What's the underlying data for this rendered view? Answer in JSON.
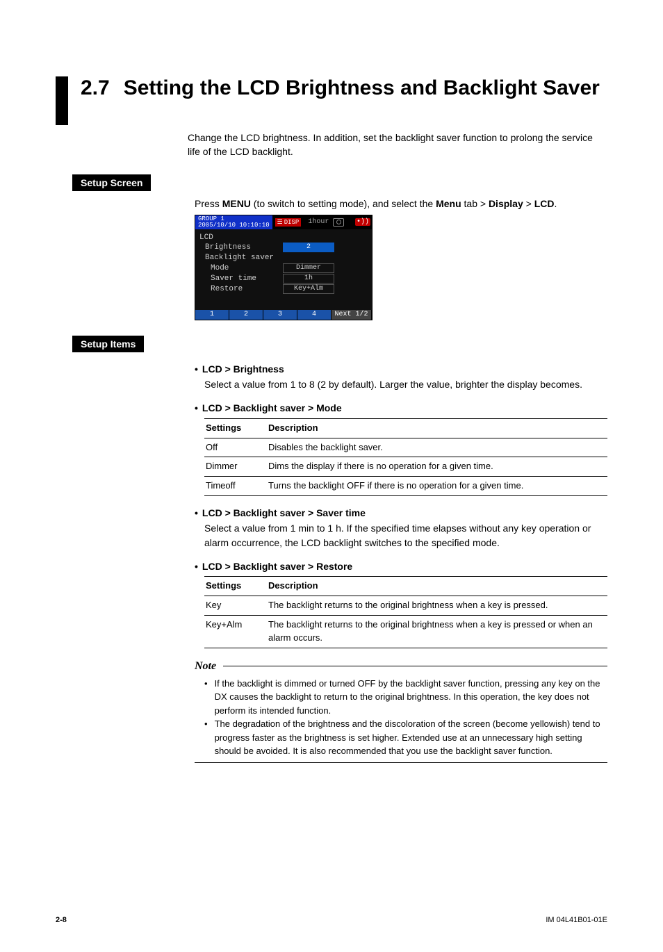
{
  "section": {
    "number": "2.7",
    "title": "Setting the LCD Brightness and Backlight Saver"
  },
  "intro": "Change the LCD brightness. In addition, set the backlight saver function to prolong the service life of the LCD backlight.",
  "tags": {
    "setup_screen": "Setup Screen",
    "setup_items": "Setup Items"
  },
  "press_line": {
    "prefix": "Press ",
    "menu1": "MENU",
    "mid": " (to switch to setting mode), and select the ",
    "menu2": "Menu",
    "sep1": " tab > ",
    "display": "Display",
    "sep2": " > ",
    "lcd": "LCD",
    "end": "."
  },
  "screenshot": {
    "group": "GROUP 1",
    "datetime": "2005/10/10 10:10:10",
    "disp": "DISP",
    "onehour": "1hour",
    "lcd_label": "LCD",
    "rows": {
      "brightness": "Brightness",
      "backlight_saver": "Backlight saver",
      "mode": "Mode",
      "saver_time": "Saver time",
      "restore": "Restore"
    },
    "vals": {
      "brightness": "2",
      "mode": "Dimmer",
      "saver_time": "1h",
      "restore": "Key+Alm"
    },
    "footer": {
      "b1": "1",
      "b2": "2",
      "b3": "3",
      "b4": "4",
      "next": "Next 1/2"
    }
  },
  "items": {
    "brightness": {
      "head": "LCD > Brightness",
      "body": "Select a value from 1 to 8 (2 by default). Larger the value, brighter the display becomes."
    },
    "mode": {
      "head": "LCD > Backlight saver > Mode",
      "th1": "Settings",
      "th2": "Description",
      "rows": [
        {
          "s": "Off",
          "d": "Disables the backlight saver."
        },
        {
          "s": "Dimmer",
          "d": "Dims the display if there is no operation for a given time."
        },
        {
          "s": "Timeoff",
          "d": "Turns the backlight OFF if there is no operation for a given time."
        }
      ]
    },
    "saver_time": {
      "head": "LCD > Backlight saver > Saver time",
      "body": "Select a value from 1 min to 1 h. If the specified time elapses without any key operation or alarm occurrence, the LCD backlight switches to the specified mode."
    },
    "restore": {
      "head": "LCD > Backlight saver > Restore",
      "th1": "Settings",
      "th2": "Description",
      "rows": [
        {
          "s": "Key",
          "d": "The backlight returns to the original brightness when a key is pressed."
        },
        {
          "s": "Key+Alm",
          "d": "The backlight returns to the original brightness when a key is pressed or when an alarm occurs."
        }
      ]
    }
  },
  "note": {
    "title": "Note",
    "items": [
      "If the backlight is dimmed or turned OFF by the backlight saver function, pressing any key on the DX causes the backlight to return to the original brightness. In this operation, the key does not perform its intended function.",
      "The degradation of the brightness and the discoloration of the screen (become yellowish) tend to progress faster as the brightness is set higher. Extended use at an unnecessary high setting should be avoided. It is also recommended that you use the backlight saver function."
    ]
  },
  "footer": {
    "page": "2-8",
    "doc": "IM 04L41B01-01E"
  }
}
